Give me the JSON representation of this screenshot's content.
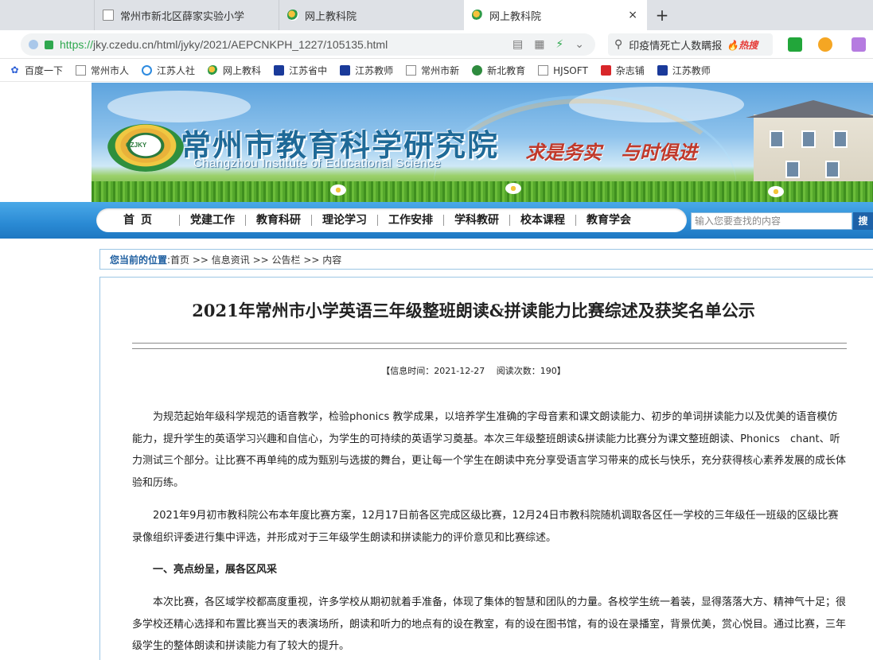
{
  "tabs": [
    {
      "title": "常州市新北区薛家实验小学",
      "icon": "document-icon"
    },
    {
      "title": "网上教科院",
      "icon": "site-favicon"
    },
    {
      "title": "网上教科院",
      "icon": "site-favicon",
      "active": true
    }
  ],
  "tab_controls": {
    "close": "×",
    "new_tab": "+"
  },
  "address": {
    "protocol": "https://",
    "url_rest": "jky.czedu.cn/html/jyky/2021/AEPCNKPH_1227/105135.html"
  },
  "search": {
    "query": "印疫情死亡人数瞒报",
    "badge": "热搜"
  },
  "bookmarks": [
    {
      "label": "百度一下",
      "icon": "paw-icon"
    },
    {
      "label": "常州市人",
      "icon": "document-icon"
    },
    {
      "label": "江苏人社",
      "icon": "circle-icon"
    },
    {
      "label": "网上教科",
      "icon": "site-favicon"
    },
    {
      "label": "江苏省中",
      "icon": "edu-icon"
    },
    {
      "label": "江苏教师",
      "icon": "edu-icon"
    },
    {
      "label": "常州市新",
      "icon": "document-icon"
    },
    {
      "label": "新北教育",
      "icon": "leaf-icon"
    },
    {
      "label": "HJSOFT",
      "icon": "document-icon"
    },
    {
      "label": "杂志铺",
      "icon": "red-icon"
    },
    {
      "label": "江苏教师",
      "icon": "edu-icon"
    }
  ],
  "banner": {
    "title": "常州市教育科学研究院",
    "subtitle": "Changzhou Institute of Educational Science",
    "logo_text": "CZJKY",
    "slogan": "求是务实　与时俱进"
  },
  "nav": {
    "items": [
      "首页",
      "党建工作",
      "教育科研",
      "理论学习",
      "工作安排",
      "学科教研",
      "校本课程",
      "教育学会"
    ],
    "search_placeholder": "输入您要查找的内容",
    "search_button": "搜"
  },
  "breadcrumb": {
    "label": "您当前的位置",
    "path": ":首页 >> 信息资讯 >> 公告栏 >> 内容"
  },
  "article": {
    "title": "2021年常州市小学英语三年级整班朗读&拼读能力比赛综述及获奖名单公示",
    "meta": "【信息时间：2021-12-27　 阅读次数：190】",
    "paragraphs": [
      "为规范起始年级科学规范的语音教学，检验phonics 教学成果，以培养学生准确的字母音素和课文朗读能力、初步的单词拼读能力以及优美的语音模仿能力，提升学生的英语学习兴趣和自信心，为学生的可持续的英语学习奠基。本次三年级整班朗读&拼读能力比赛分为课文整班朗读、Phonics　chant、听力测试三个部分。让比赛不再单纯的成为甄别与选拔的舞台，更让每一个学生在朗读中充分享受语言学习带来的成长与快乐，充分获得核心素养发展的成长体验和历练。",
      "2021年9月初市教科院公布本年度比赛方案，12月17日前各区完成区级比赛，12月24日市教科院随机调取各区任一学校的三年级任一班级的区级比赛录像组织评委进行集中评选，并形成对于三年级学生朗读和拼读能力的评价意见和比赛综述。",
      "本次比赛，各区域学校都高度重视，许多学校从期初就着手准备，体现了集体的智慧和团队的力量。各校学生统一着装，显得落落大方、精神气十足；很多学校还精心选择和布置比赛当天的表演场所，朗读和听力的地点有的设在教室，有的设在图书馆，有的设在录播室，背景优美，赏心悦目。通过比赛，三年级学生的整体朗读和拼读能力有了较大的提升。"
    ],
    "heading1": "一、亮点纷呈，展各区风采"
  }
}
